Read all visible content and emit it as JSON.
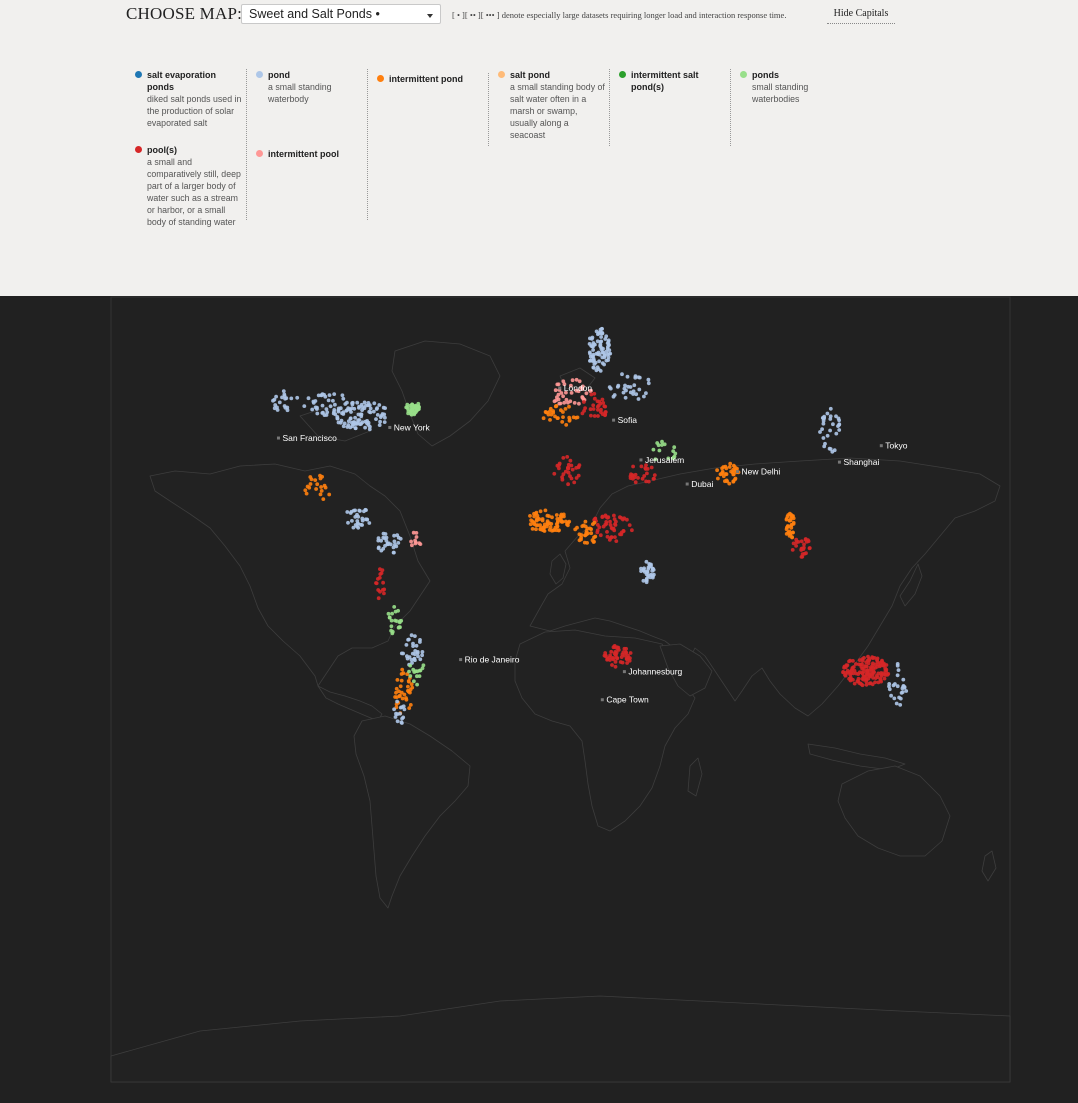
{
  "header": {
    "choose_label": "CHOOSE MAP:",
    "selected_map": "Sweet and Salt Ponds •",
    "note": "[ • ][ •• ][ ••• ] denote especially large datasets requiring longer load and interaction response time.",
    "hide_capitals_label": "Hide Capitals"
  },
  "legend": [
    {
      "name": "salt evaporation ponds",
      "desc": "diked salt ponds used in the production of solar evaporated salt",
      "color": "#1f77b4"
    },
    {
      "name": "pond",
      "desc": "a small standing waterbody",
      "color": "#aec7e8"
    },
    {
      "name": "intermittent pond",
      "desc": "",
      "color": "#ff7f0e"
    },
    {
      "name": "salt pond",
      "desc": "a small standing body of salt water often in a marsh or swamp, usually along a seacoast",
      "color": "#ffbb78"
    },
    {
      "name": "intermittent salt pond(s)",
      "desc": "",
      "color": "#2ca02c"
    },
    {
      "name": "ponds",
      "desc": "small standing waterbodies",
      "color": "#98df8a"
    },
    {
      "name": "pool(s)",
      "desc": "a small and comparatively still, deep part of a larger body of water such as a stream or harbor, or a small body of standing water",
      "color": "#d62728"
    },
    {
      "name": "intermittent pool",
      "desc": "",
      "color": "#ff9896"
    }
  ],
  "map": {
    "background": "#212121",
    "land_stroke": "#3d3d3d",
    "capitals": [
      {
        "name": "New York",
        "lon": -74.0,
        "lat": 40.7
      },
      {
        "name": "San Francisco",
        "lon": -122.4,
        "lat": 37.8
      },
      {
        "name": "London",
        "lon": -0.1,
        "lat": 51.5
      },
      {
        "name": "Sofia",
        "lon": 23.3,
        "lat": 42.7
      },
      {
        "name": "Jerusalem",
        "lon": 35.2,
        "lat": 31.8
      },
      {
        "name": "Dubai",
        "lon": 55.3,
        "lat": 25.2
      },
      {
        "name": "New Delhi",
        "lon": 77.2,
        "lat": 28.6
      },
      {
        "name": "Shanghai",
        "lon": 121.5,
        "lat": 31.2
      },
      {
        "name": "Tokyo",
        "lon": 139.7,
        "lat": 35.7
      },
      {
        "name": "Rio de Janeiro",
        "lon": -43.2,
        "lat": -22.9
      },
      {
        "name": "Johannesburg",
        "lon": 28.0,
        "lat": -26.2
      },
      {
        "name": "Cape Town",
        "lon": 18.4,
        "lat": -33.9
      }
    ],
    "clusters": [
      {
        "lon": -86,
        "lat": 44,
        "rlon": 12,
        "rlat": 4,
        "n": 90,
        "color": "#aec7e8"
      },
      {
        "lon": -100,
        "lat": 47,
        "rlon": 12,
        "rlat": 3,
        "n": 40,
        "color": "#aec7e8"
      },
      {
        "lon": -120,
        "lat": 48,
        "rlon": 6,
        "rlat": 3,
        "n": 20,
        "color": "#aec7e8"
      },
      {
        "lon": -64,
        "lat": 46,
        "rlon": 3,
        "rlat": 2,
        "n": 40,
        "color": "#98df8a"
      },
      {
        "lon": -105,
        "lat": 24,
        "rlon": 6,
        "rlat": 4,
        "n": 20,
        "color": "#ff7f0e"
      },
      {
        "lon": -88,
        "lat": 16,
        "rlon": 6,
        "rlat": 3,
        "n": 30,
        "color": "#aec7e8"
      },
      {
        "lon": -74,
        "lat": 9,
        "rlon": 6,
        "rlat": 3,
        "n": 30,
        "color": "#aec7e8"
      },
      {
        "lon": -63,
        "lat": 10,
        "rlon": 3,
        "rlat": 2,
        "n": 10,
        "color": "#ff9896"
      },
      {
        "lon": -78,
        "lat": -2,
        "rlon": 2,
        "rlat": 5,
        "n": 15,
        "color": "#d62728"
      },
      {
        "lon": -72,
        "lat": -12,
        "rlon": 3,
        "rlat": 4,
        "n": 20,
        "color": "#98df8a"
      },
      {
        "lon": -64,
        "lat": -20,
        "rlon": 5,
        "rlat": 5,
        "n": 30,
        "color": "#aec7e8"
      },
      {
        "lon": -68,
        "lat": -32,
        "rlon": 4,
        "rlat": 7,
        "n": 35,
        "color": "#ff7f0e"
      },
      {
        "lon": -62,
        "lat": -26,
        "rlon": 4,
        "rlat": 4,
        "n": 15,
        "color": "#98df8a"
      },
      {
        "lon": -70,
        "lat": -38,
        "rlon": 3,
        "rlat": 4,
        "n": 15,
        "color": "#aec7e8"
      },
      {
        "lon": 17,
        "lat": 62,
        "rlon": 5,
        "rlat": 6,
        "n": 80,
        "color": "#aec7e8"
      },
      {
        "lon": 5,
        "lat": 50,
        "rlon": 9,
        "rlat": 4,
        "n": 40,
        "color": "#ff9896"
      },
      {
        "lon": 0,
        "lat": 44,
        "rlon": 8,
        "rlat": 3,
        "n": 30,
        "color": "#ff7f0e"
      },
      {
        "lon": 15,
        "lat": 46,
        "rlon": 6,
        "rlat": 4,
        "n": 30,
        "color": "#d62728"
      },
      {
        "lon": 30,
        "lat": 52,
        "rlon": 10,
        "rlat": 4,
        "n": 30,
        "color": "#aec7e8"
      },
      {
        "lon": 3,
        "lat": 29,
        "rlon": 6,
        "rlat": 4,
        "n": 30,
        "color": "#d62728"
      },
      {
        "lon": -5,
        "lat": 15,
        "rlon": 10,
        "rlat": 3,
        "n": 80,
        "color": "#ff7f0e"
      },
      {
        "lon": 22,
        "lat": 13,
        "rlon": 10,
        "rlat": 4,
        "n": 50,
        "color": "#d62728"
      },
      {
        "lon": 12,
        "lat": 12,
        "rlon": 6,
        "rlat": 3,
        "n": 30,
        "color": "#ff7f0e"
      },
      {
        "lon": 38,
        "lat": 1,
        "rlon": 3,
        "rlat": 3,
        "n": 35,
        "color": "#aec7e8"
      },
      {
        "lon": 25,
        "lat": -22,
        "rlon": 6,
        "rlat": 3,
        "n": 50,
        "color": "#d62728"
      },
      {
        "lon": 36,
        "lat": 28,
        "rlon": 6,
        "rlat": 3,
        "n": 25,
        "color": "#d62728"
      },
      {
        "lon": 45,
        "lat": 34,
        "rlon": 6,
        "rlat": 3,
        "n": 15,
        "color": "#98df8a"
      },
      {
        "lon": 73,
        "lat": 28,
        "rlon": 5,
        "rlat": 3,
        "n": 35,
        "color": "#ff7f0e"
      },
      {
        "lon": 100,
        "lat": 14,
        "rlon": 2,
        "rlat": 4,
        "n": 35,
        "color": "#ff7f0e"
      },
      {
        "lon": 105,
        "lat": 8,
        "rlon": 4,
        "rlat": 3,
        "n": 25,
        "color": "#d62728"
      },
      {
        "lon": 118,
        "lat": 40,
        "rlon": 5,
        "rlat": 6,
        "n": 30,
        "color": "#aec7e8"
      },
      {
        "lon": 133,
        "lat": -26,
        "rlon": 10,
        "rlat": 4,
        "n": 140,
        "color": "#d62728"
      },
      {
        "lon": 147,
        "lat": -30,
        "rlon": 4,
        "rlat": 6,
        "n": 25,
        "color": "#aec7e8"
      }
    ]
  }
}
